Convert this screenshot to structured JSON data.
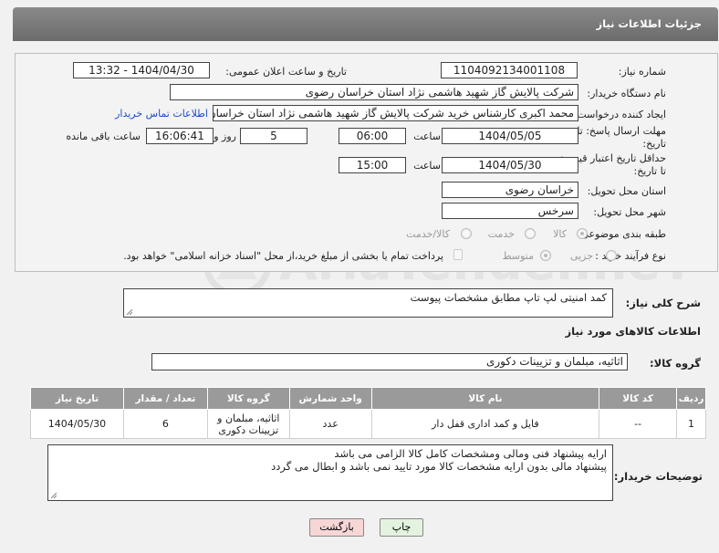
{
  "header": {
    "title": "جزئیات اطلاعات نیاز"
  },
  "watermark": {
    "text": "AriaTender.neT"
  },
  "fields": {
    "need_number": {
      "label": "شماره نیاز:",
      "value": "1104092134001108"
    },
    "announce_datetime": {
      "label": "تاریخ و ساعت اعلان عمومی:",
      "value": "1404/04/30 - 13:32"
    },
    "buyer_org": {
      "label": "نام دستگاه خریدار:",
      "value": "شرکت پالایش گاز شهید هاشمی نژاد   استان خراسان رضوی"
    },
    "requester": {
      "label": "ایجاد کننده درخواست:",
      "value": "محمد اکبری کارشناس خرید شرکت پالایش گاز شهید هاشمی نژاد   استان خراسان",
      "contact_link": "اطلاعات تماس خریدار"
    },
    "reply_deadline": {
      "label_line1": "مهلت ارسال پاسخ: تا",
      "label_line2": "تاریخ:",
      "date": "1404/05/05",
      "time_label": "ساعت",
      "time": "06:00",
      "days": "5",
      "days_label": "روز و",
      "remaining": "16:06:41",
      "remaining_label": "ساعت باقی مانده"
    },
    "price_validity": {
      "label_line1": "حداقل تاریخ اعتبار قیمت:",
      "label_line2": "تا تاریخ:",
      "date": "1404/05/30",
      "time_label": "ساعت",
      "time": "15:00"
    },
    "delivery_province": {
      "label": "استان محل تحویل:",
      "value": "خراسان رضوی"
    },
    "delivery_city": {
      "label": "شهر محل تحویل:",
      "value": "سرخس"
    },
    "category": {
      "label": "طبقه بندی موضوعی:",
      "options": [
        "کالا",
        "خدمت",
        "کالا/خدمت"
      ]
    },
    "purchase_type": {
      "label": "نوع فرآیند خرید :",
      "options": [
        "جزیی",
        "متوسط"
      ],
      "payment_note": "پرداخت تمام یا بخشی از مبلغ خرید،از محل \"اسناد خزانه اسلامی\" خواهد بود."
    }
  },
  "description": {
    "label": "شرح کلی نیاز:",
    "value": "کمد امنیتی لپ تاپ مطابق مشخصات پیوست"
  },
  "goods_info": {
    "title": "اطلاعات کالاهای مورد نیاز"
  },
  "goods_group": {
    "label": "گروه کالا:",
    "value": "اثاثیه، مبلمان و تزیینات دکوری"
  },
  "table": {
    "headers": [
      "ردیف",
      "کد کالا",
      "نام کالا",
      "واحد شمارش",
      "گروه کالا",
      "تعداد / مقدار",
      "تاریخ نیاز"
    ],
    "rows": [
      {
        "row": "1",
        "code": "--",
        "name": "فایل و کمد اداری قفل دار",
        "unit": "عدد",
        "group_line1": "اثاثیه، مبلمان و",
        "group_line2": "تزیینات دکوری",
        "qty": "6",
        "date": "1404/05/30"
      }
    ]
  },
  "buyer_notes": {
    "label": "توضیحات خریدار:",
    "line1": "ارایه پیشنهاد فنی ومالی ومشخصات کامل کالا الزامی می باشد",
    "line2": "پیشنهاد مالی بدون ارایه مشخصات کالا مورد تایید نمی باشد و ابطال می گردد"
  },
  "buttons": {
    "print": "چاپ",
    "back": "بازگشت"
  },
  "colors": {
    "header_bg": "#7a7a7a",
    "link": "#1b4dc5",
    "back_button": "#f7d6d6",
    "print_button": "#e4f3e0"
  }
}
